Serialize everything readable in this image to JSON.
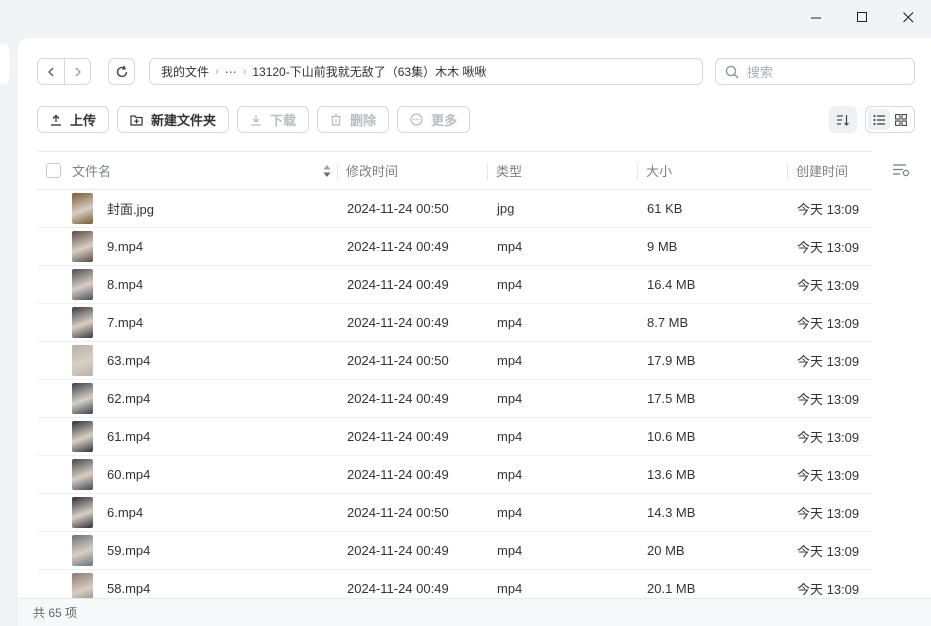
{
  "window": {
    "controls": [
      "minimize",
      "maximize",
      "close"
    ]
  },
  "breadcrumb": {
    "root": "我的文件",
    "more": "⋯",
    "current": "13120-下山前我就无敌了（63集）木木 啾啾"
  },
  "search": {
    "placeholder": "搜索"
  },
  "toolbar": {
    "upload": "上传",
    "new_folder": "新建文件夹",
    "download": "下载",
    "delete": "删除",
    "more": "更多"
  },
  "table": {
    "headers": {
      "name": "文件名",
      "modified": "修改时间",
      "type": "类型",
      "size": "大小",
      "created": "创建时间"
    },
    "rows": [
      {
        "name": "封面.jpg",
        "modified": "2024-11-24 00:50",
        "type": "jpg",
        "size": "61 KB",
        "created": "今天 13:09",
        "thumb": "#7a5a2e"
      },
      {
        "name": "9.mp4",
        "modified": "2024-11-24 00:49",
        "type": "mp4",
        "size": "9 MB",
        "created": "今天 13:09",
        "thumb": "#5b4a44"
      },
      {
        "name": "8.mp4",
        "modified": "2024-11-24 00:49",
        "type": "mp4",
        "size": "16.4 MB",
        "created": "今天 13:09",
        "thumb": "#4a4e52"
      },
      {
        "name": "7.mp4",
        "modified": "2024-11-24 00:49",
        "type": "mp4",
        "size": "8.7 MB",
        "created": "今天 13:09",
        "thumb": "#3d3a3a"
      },
      {
        "name": "63.mp4",
        "modified": "2024-11-24 00:50",
        "type": "mp4",
        "size": "17.9 MB",
        "created": "今天 13:09",
        "thumb": "#b9b2a8"
      },
      {
        "name": "62.mp4",
        "modified": "2024-11-24 00:49",
        "type": "mp4",
        "size": "17.5 MB",
        "created": "今天 13:09",
        "thumb": "#3b4046"
      },
      {
        "name": "61.mp4",
        "modified": "2024-11-24 00:49",
        "type": "mp4",
        "size": "10.6 MB",
        "created": "今天 13:09",
        "thumb": "#2f3338"
      },
      {
        "name": "60.mp4",
        "modified": "2024-11-24 00:49",
        "type": "mp4",
        "size": "13.6 MB",
        "created": "今天 13:09",
        "thumb": "#44474b"
      },
      {
        "name": "6.mp4",
        "modified": "2024-11-24 00:50",
        "type": "mp4",
        "size": "14.3 MB",
        "created": "今天 13:09",
        "thumb": "#2c2e31"
      },
      {
        "name": "59.mp4",
        "modified": "2024-11-24 00:49",
        "type": "mp4",
        "size": "20 MB",
        "created": "今天 13:09",
        "thumb": "#6a7178"
      },
      {
        "name": "58.mp4",
        "modified": "2024-11-24 00:49",
        "type": "mp4",
        "size": "20.1 MB",
        "created": "今天 13:09",
        "thumb": "#8a7a6a"
      }
    ]
  },
  "status": {
    "count": "共 65 项"
  }
}
